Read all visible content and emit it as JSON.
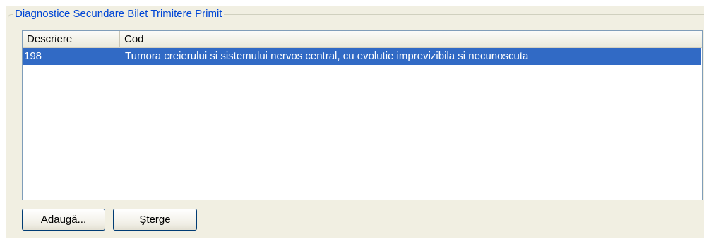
{
  "group": {
    "title": "Diagnostice Secundare Bilet Trimitere Primit"
  },
  "table": {
    "columns": [
      "Descriere",
      "Cod"
    ],
    "rows": [
      {
        "descriere": "198",
        "cod": "Tumora creierului si sistemului nervos central, cu evolutie imprevizibila si necunoscuta",
        "selected": true
      }
    ]
  },
  "buttons": {
    "add_label": "Adaugă...",
    "delete_label": "Şterge"
  },
  "colors": {
    "group_title": "#0046d5",
    "selection": "#316ac5",
    "panel": "#f1efe2",
    "list_border": "#7f9db9"
  }
}
